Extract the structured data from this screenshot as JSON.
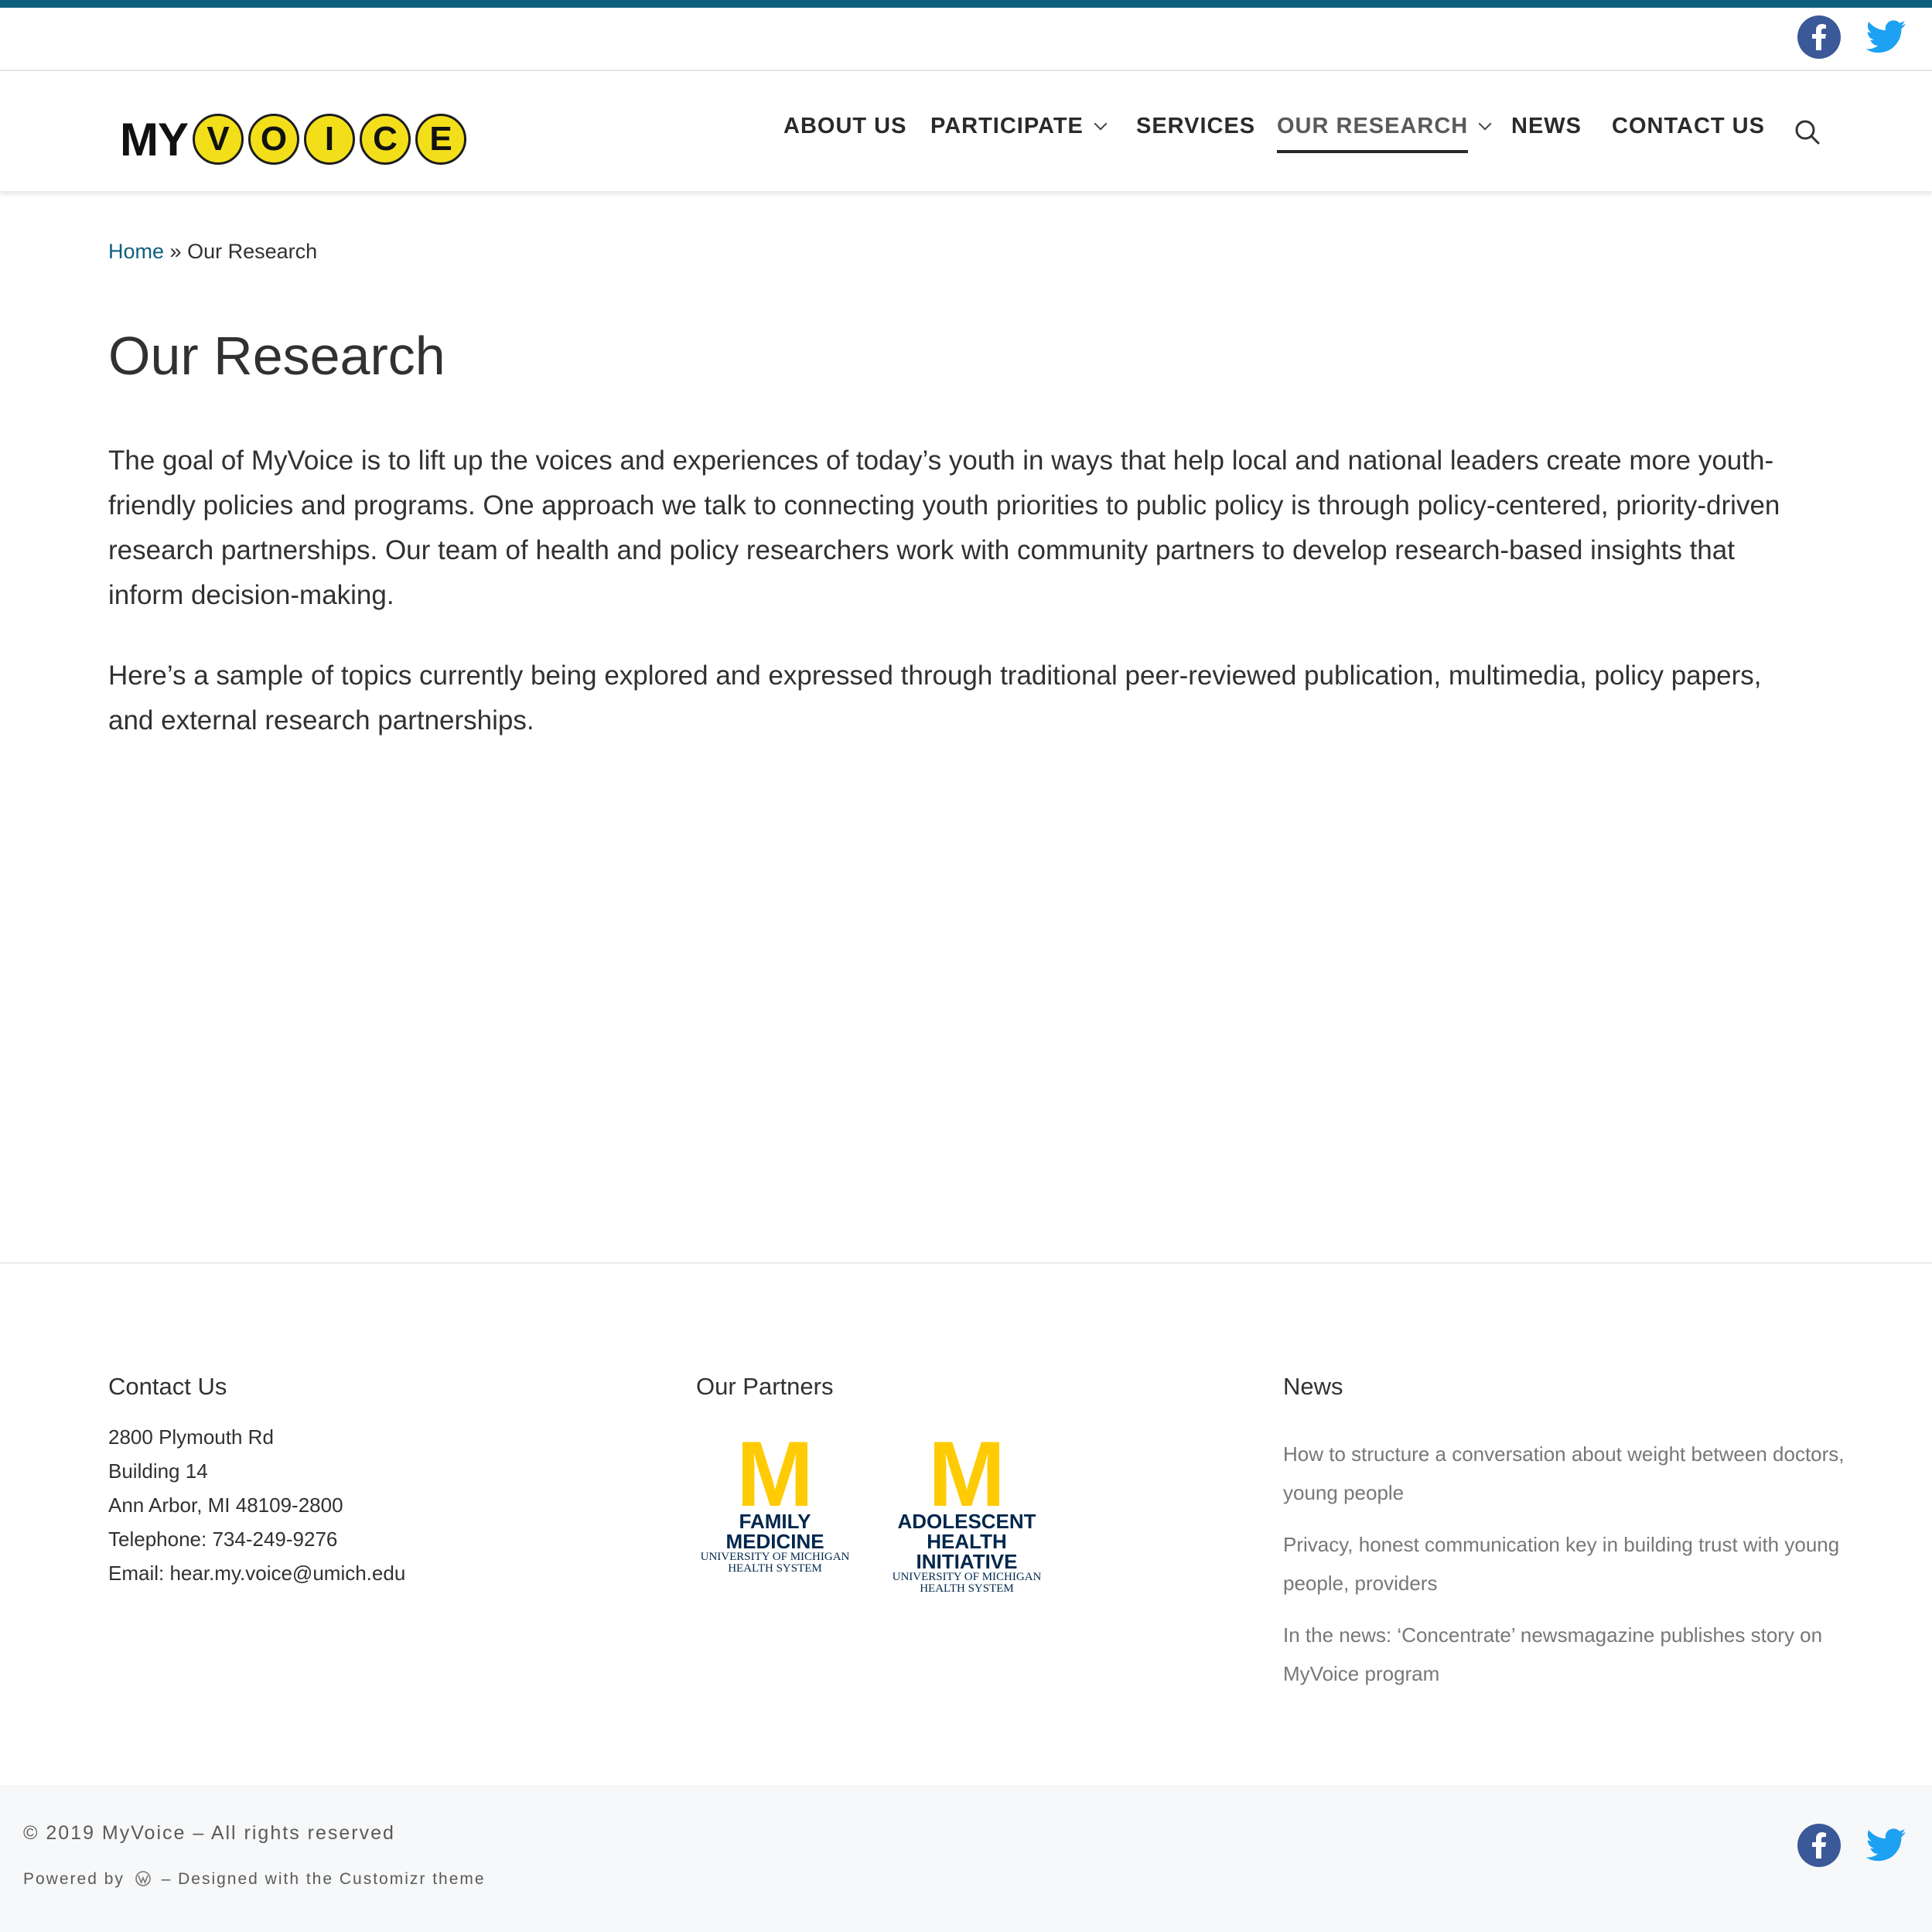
{
  "colors": {
    "accent": "#0d5f7e",
    "facebook": "#3b5998",
    "twitter": "#1da1f2",
    "umich_maize": "#ffcb05",
    "umich_blue": "#00274c"
  },
  "logo": {
    "text_my": "MY",
    "letters": [
      "V",
      "O",
      "I",
      "C",
      "E"
    ]
  },
  "nav": {
    "items": [
      {
        "label": "ABOUT US",
        "has_dropdown": false
      },
      {
        "label": "PARTICIPATE",
        "has_dropdown": true
      },
      {
        "label": "SERVICES",
        "has_dropdown": false
      },
      {
        "label": "OUR RESEARCH",
        "has_dropdown": true,
        "active": true
      },
      {
        "label": "NEWS",
        "has_dropdown": false
      },
      {
        "label": "CONTACT US",
        "has_dropdown": false
      }
    ],
    "search_icon": "search-icon"
  },
  "breadcrumb": {
    "home": "Home",
    "separator": " » ",
    "current": "Our Research"
  },
  "page": {
    "title": "Our Research",
    "paragraphs": [
      "The goal of MyVoice is to lift up the voices and experiences of today’s youth in ways that help local and national leaders create more youth-friendly policies and programs. One approach we talk to connecting youth priorities to public policy is through policy-centered, priority-driven research partnerships. Our team of health and policy researchers work with community partners to develop research-based insights that inform decision-making.",
      "Here’s a sample of topics currently being explored and expressed through traditional peer-reviewed publication, multimedia, policy papers, and external research partnerships."
    ]
  },
  "footer": {
    "contact": {
      "heading": "Contact Us",
      "lines": [
        "2800 Plymouth Rd",
        "Building 14",
        "Ann Arbor, MI 48109-2800",
        "Telephone: 734-249-9276",
        "Email: hear.my.voice@umich.edu"
      ]
    },
    "partners": {
      "heading": "Our Partners",
      "logos": [
        {
          "letter": "M",
          "title": "FAMILY MEDICINE",
          "sub1": "UNIVERSITY OF MICHIGAN",
          "sub2": "HEALTH SYSTEM"
        },
        {
          "letter": "M",
          "title": "ADOLESCENT HEALTH INITIATIVE",
          "sub1": "UNIVERSITY OF MICHIGAN",
          "sub2": "HEALTH SYSTEM"
        }
      ]
    },
    "news": {
      "heading": "News",
      "items": [
        "How to structure a conversation about weight between doctors, young people",
        "Privacy, honest communication key in building trust with young people, providers",
        "In the news: ‘Concentrate’ newsmagazine publishes story on MyVoice program"
      ]
    }
  },
  "bottom": {
    "copyright": "© 2019 MyVoice – All rights reserved",
    "powered_prefix": "Powered by",
    "powered_suffix": "– Designed with the Customizr theme"
  }
}
